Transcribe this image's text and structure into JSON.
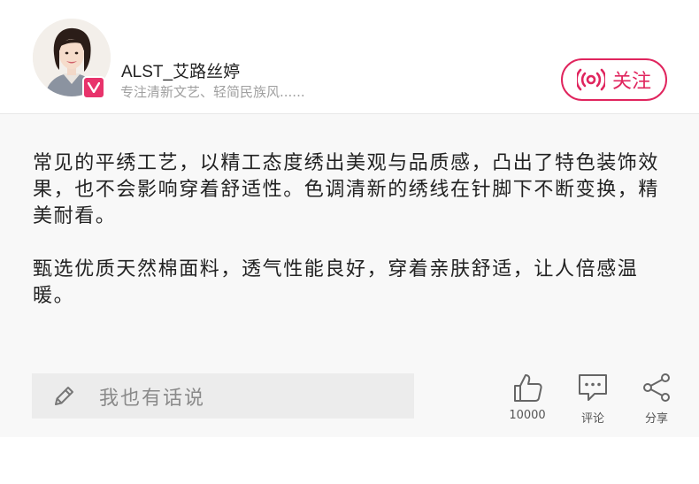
{
  "author": {
    "name": "ALST_艾路丝婷",
    "description": "专注清新文艺、轻简民族风......",
    "avatar_icon": "user-avatar",
    "badge_icon": "vip-v-badge"
  },
  "follow_button": {
    "label": "关注",
    "icon": "broadcast-icon",
    "color": "#e0255e"
  },
  "post": {
    "paragraphs": [
      "常见的平绣工艺，以精工态度绣出美观与品质感，凸出了特色装饰效果，也不会影响穿着舒适性。色调清新的绣线在针脚下不断变换，精美耐看。",
      "甄选优质天然棉面料，透气性能良好，穿着亲肤舒适，让人倍感温暖。"
    ]
  },
  "comment_input": {
    "placeholder": "我也有话说",
    "icon": "pen-icon"
  },
  "actions": {
    "like": {
      "icon": "thumbs-up-icon",
      "label": "10000"
    },
    "comment": {
      "icon": "comment-icon",
      "label": "评论"
    },
    "share": {
      "icon": "share-icon",
      "label": "分享"
    }
  },
  "colors": {
    "accent": "#e0255e",
    "badge": "#e8336b",
    "content_bg": "#f8f8f8",
    "input_bg": "#ececec"
  }
}
